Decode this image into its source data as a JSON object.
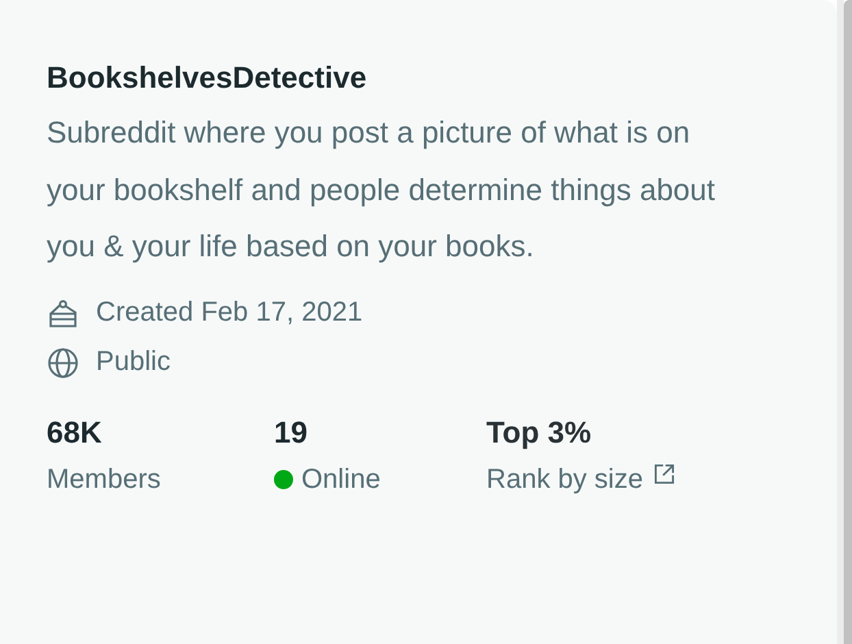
{
  "community": {
    "name": "BookshelvesDetective",
    "description": "Subreddit where you post a picture of what is on your bookshelf and people determine things about you & your life based on your books.",
    "meta": [
      {
        "kind": "created",
        "text": "Created Feb 17, 2021"
      },
      {
        "kind": "visibility",
        "text": "Public"
      }
    ],
    "stats": [
      {
        "kind": "plain",
        "value": "68K",
        "label": "Members"
      },
      {
        "kind": "online",
        "value": "19",
        "label": "Online"
      },
      {
        "kind": "link",
        "value": "Top 3%",
        "label": "Rank by size"
      }
    ]
  }
}
